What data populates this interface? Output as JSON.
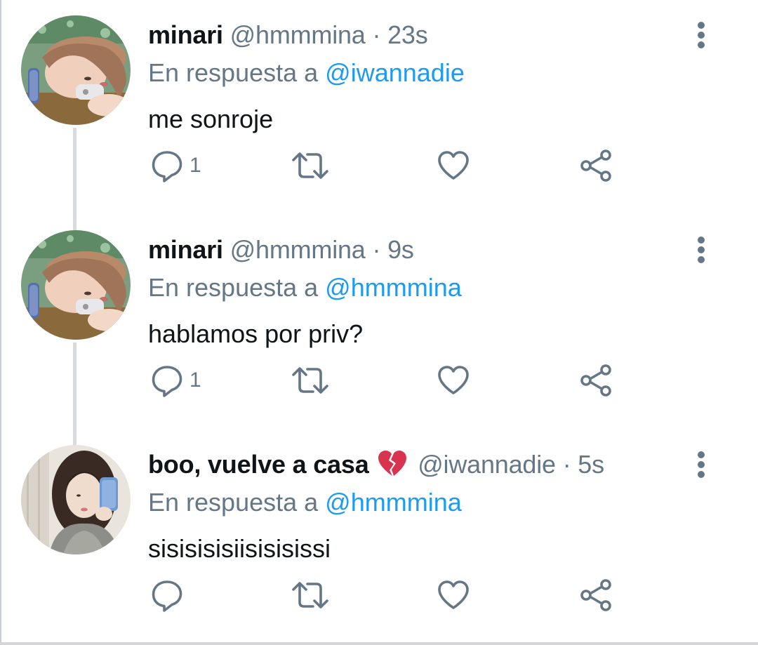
{
  "tweets": [
    {
      "display_name": "minari",
      "handle": "@hmmmina",
      "separator": "·",
      "time": "23s",
      "reply_prefix": "En respuesta a",
      "reply_to": "@iwannadie",
      "text": "me sonroje",
      "reply_count": "1",
      "avatar": "girl-lying-with-phone-avatar"
    },
    {
      "display_name": "minari",
      "handle": "@hmmmina",
      "separator": "·",
      "time": "9s",
      "reply_prefix": "En respuesta a",
      "reply_to": "@hmmmina",
      "text": "hablamos por priv?",
      "reply_count": "1",
      "avatar": "girl-lying-with-phone-avatar"
    },
    {
      "display_name": "boo, vuelve a casa",
      "name_emoji": "broken-heart-icon",
      "handle": "@iwannadie",
      "separator": "·",
      "time": "5s",
      "reply_prefix": "En respuesta a",
      "reply_to": "@hmmmina",
      "text": "sisisisisiisisisissi",
      "reply_count": "",
      "avatar": "girl-mirror-selfie-avatar"
    }
  ],
  "icons": {
    "reply": "speech-bubble-icon",
    "retweet": "retweet-arrows-icon",
    "like": "heart-outline-icon",
    "share": "share-nodes-icon",
    "more": "vertical-ellipsis-icon"
  },
  "colors": {
    "link": "#1d9bf0",
    "secondary_text": "#657786",
    "primary_text": "#0f1419",
    "thread_line": "#d7dbdf"
  }
}
